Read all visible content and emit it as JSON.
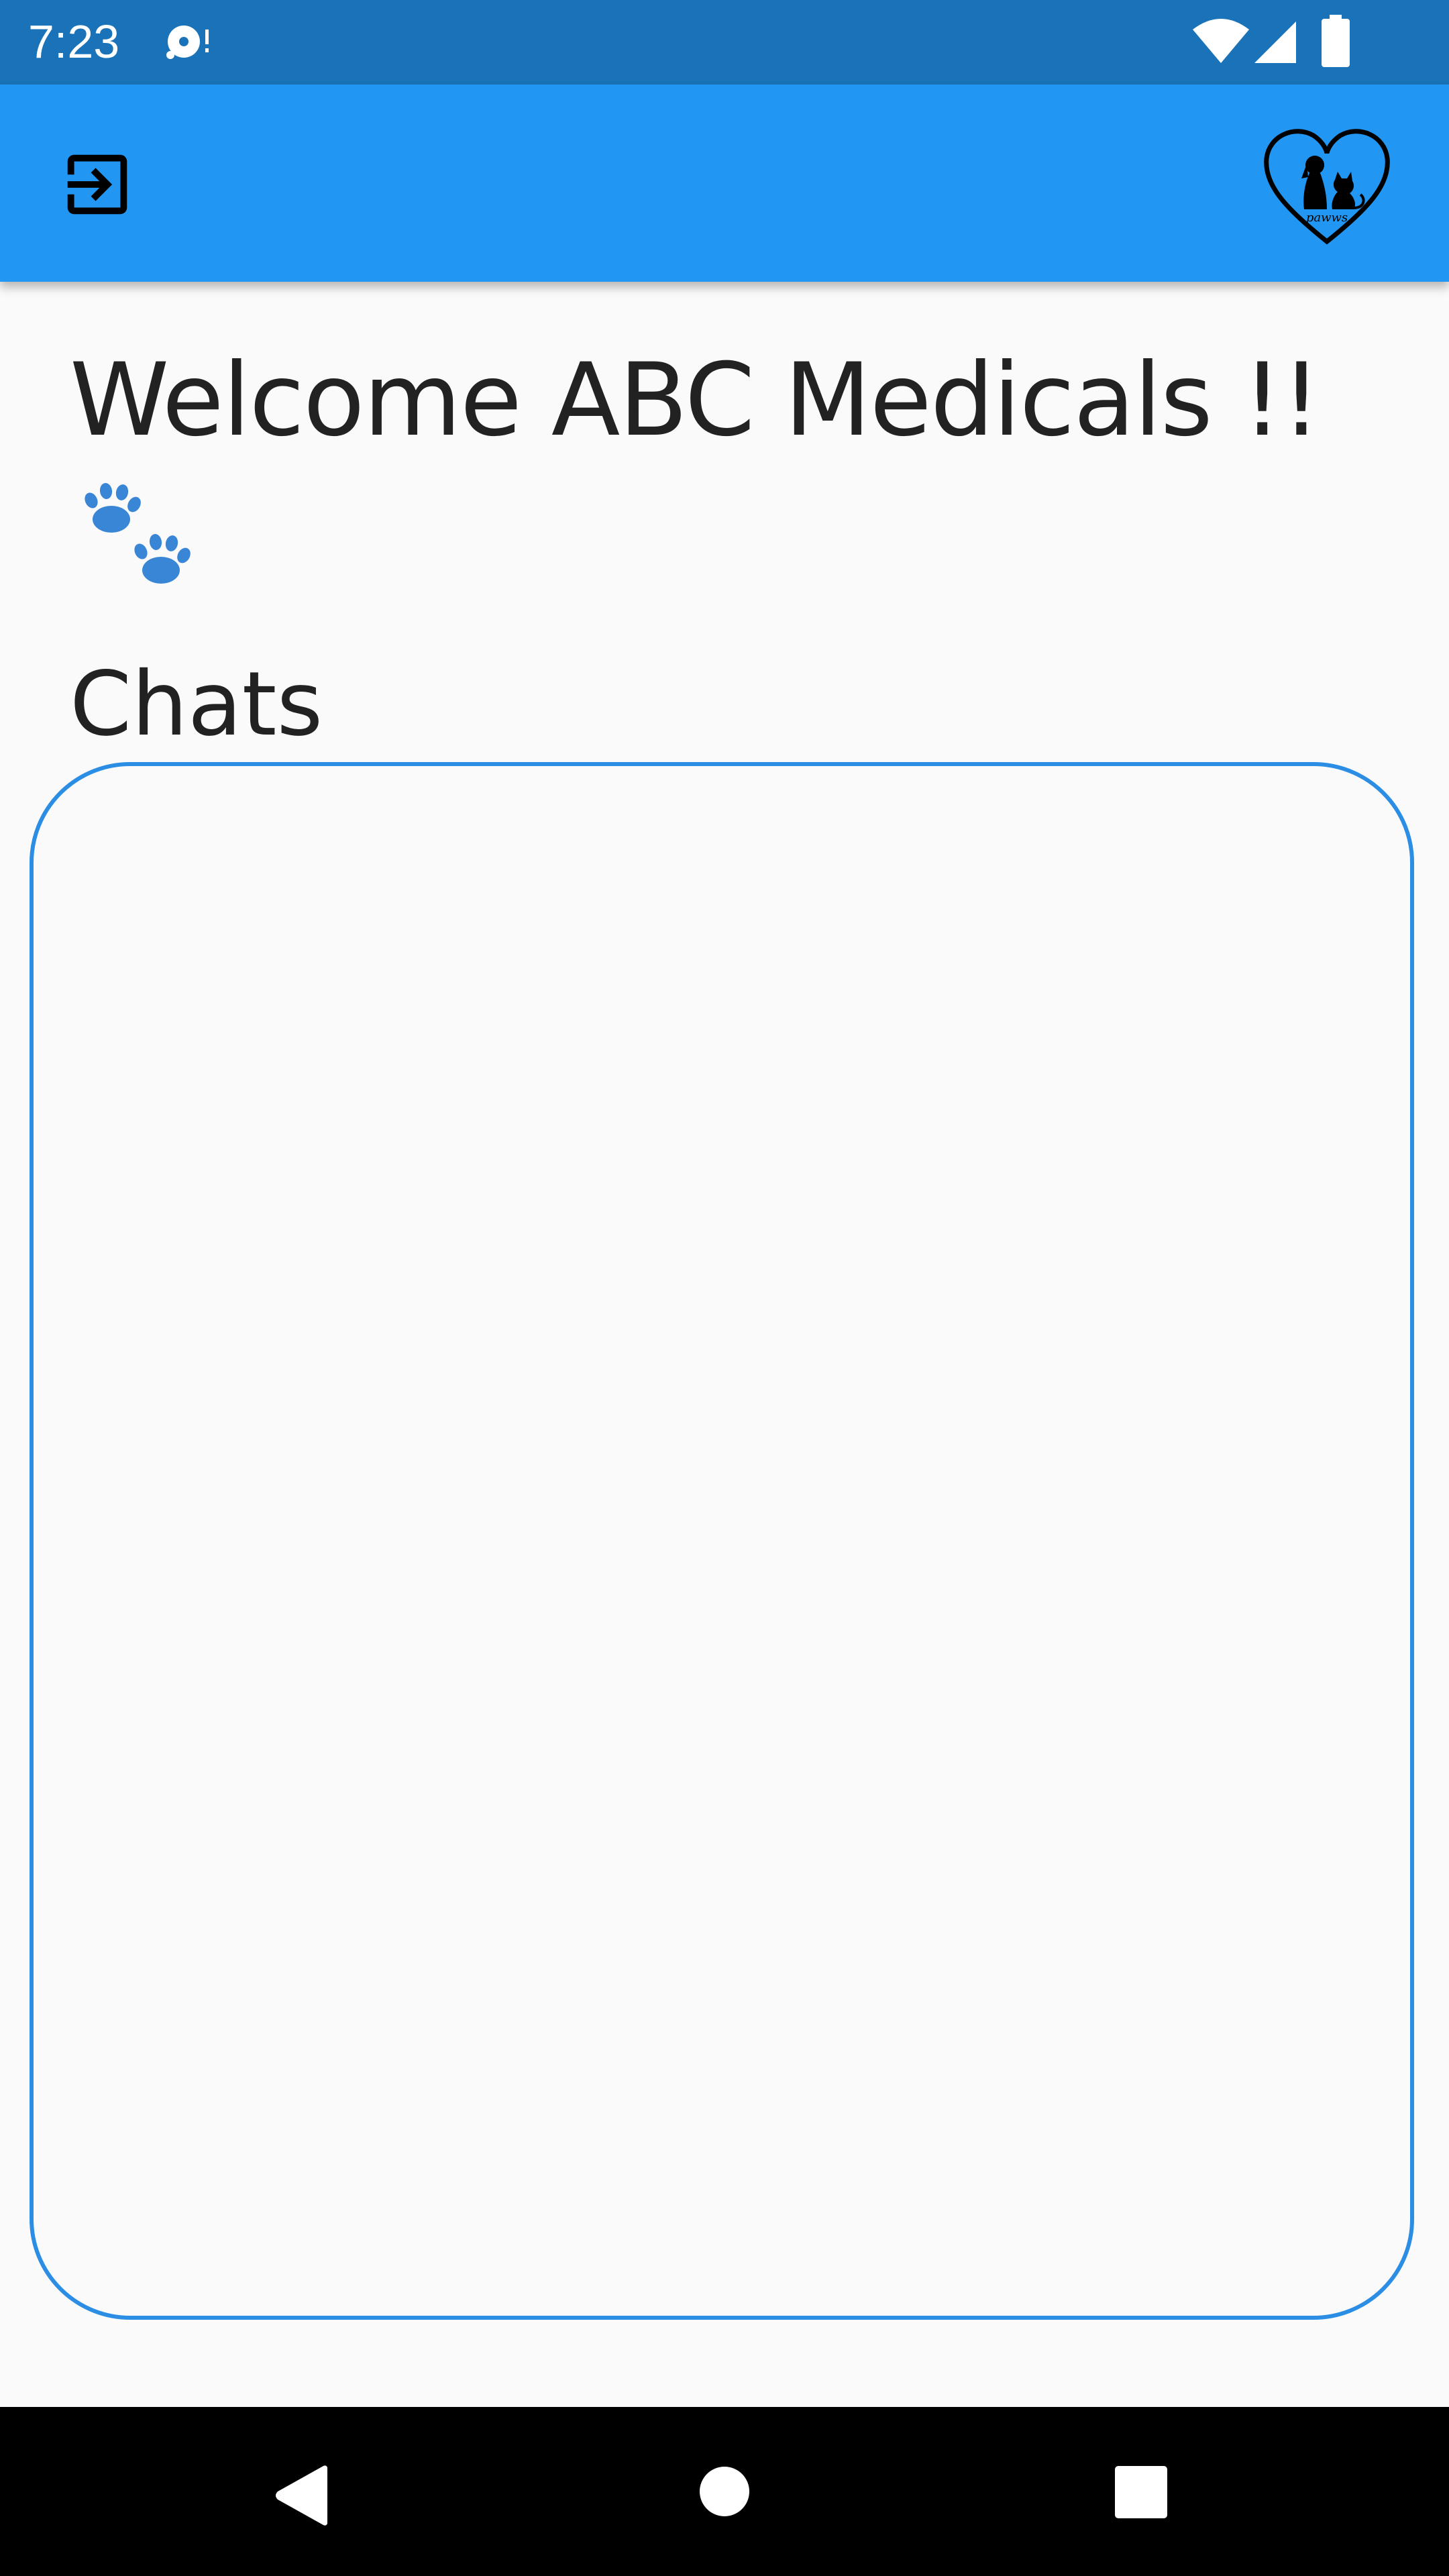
{
  "status_bar": {
    "time": "7:23",
    "icons": [
      "notification-icon",
      "wifi-icon",
      "signal-icon",
      "battery-icon"
    ]
  },
  "app_bar": {
    "left_action": "logout-icon",
    "right_logo": "paws-heart-logo-icon",
    "logo_text": "pawws"
  },
  "main": {
    "welcome_text": "Welcome ABC Medicals !!",
    "decoration": "paws-icon",
    "chats_heading": "Chats",
    "chats_items": []
  },
  "nav_bar": {
    "buttons": [
      "back-icon",
      "home-icon",
      "recents-icon"
    ]
  },
  "colors": {
    "status_bar": "#1a73b8",
    "app_bar": "#2196f3",
    "accent": "#2b8ee4",
    "paw": "#3a86d6",
    "background": "#fafafa",
    "text": "#222222"
  }
}
